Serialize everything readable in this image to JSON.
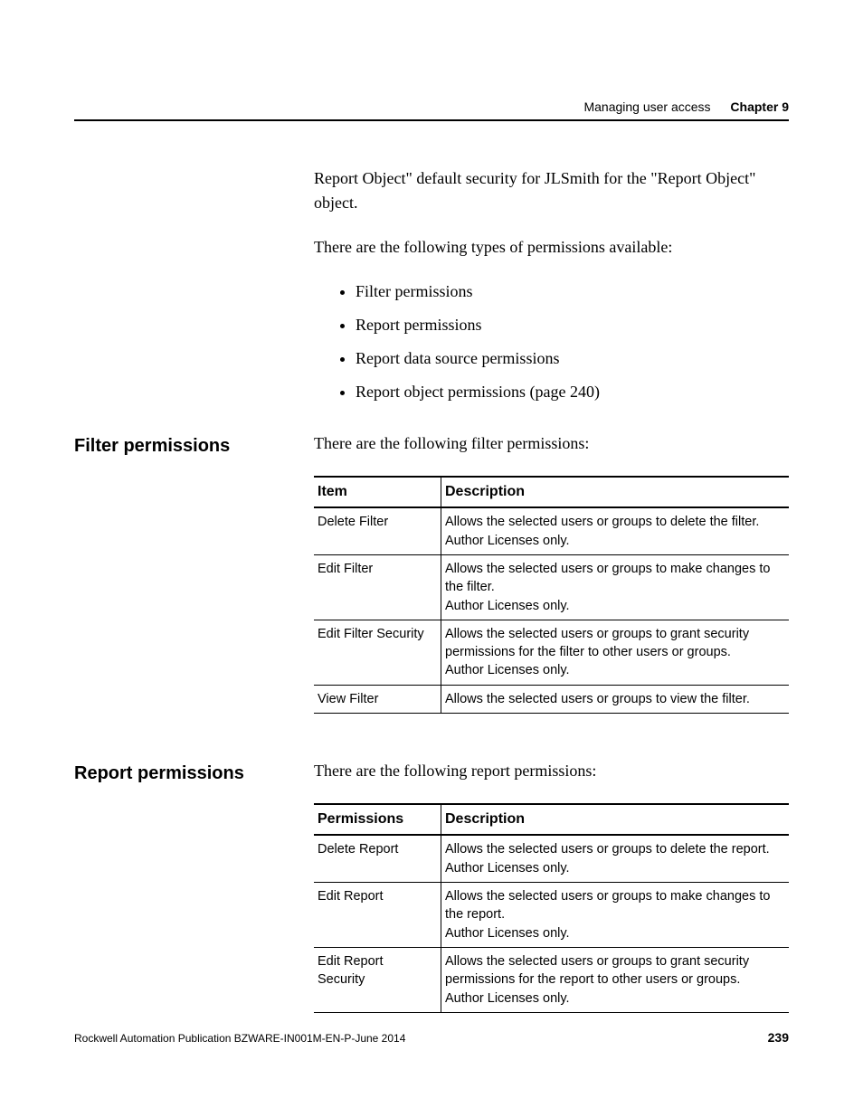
{
  "header": {
    "section": "Managing user access",
    "chapter": "Chapter 9"
  },
  "intro": {
    "p1": "Report Object\" default security for JLSmith for the \"Report Object\" object.",
    "p2": "There are the following types of permissions available:",
    "bullets": [
      "Filter permissions",
      "Report permissions",
      "Report data source permissions",
      "Report object permissions (page 240)"
    ]
  },
  "sections": [
    {
      "title": "Filter permissions",
      "lead": "There are the following filter permissions:",
      "headers": [
        "Item",
        "Description"
      ],
      "rows": [
        {
          "c0": "Delete Filter",
          "c1": "Allows the selected users or groups to delete the filter.\nAuthor Licenses only."
        },
        {
          "c0": "Edit Filter",
          "c1": "Allows the selected users or groups to make changes to the filter.\nAuthor Licenses only."
        },
        {
          "c0": "Edit Filter Security",
          "c1": "Allows the selected users or groups to grant security permissions for the filter to other users or groups.\nAuthor Licenses only."
        },
        {
          "c0": "View Filter",
          "c1": "Allows the selected users or groups to view the filter."
        }
      ]
    },
    {
      "title": "Report permissions",
      "lead": "There are the following report permissions:",
      "headers": [
        "Permissions",
        "Description"
      ],
      "rows": [
        {
          "c0": "Delete Report",
          "c1": "Allows the selected users or groups to delete the report.\nAuthor Licenses only."
        },
        {
          "c0": "Edit Report",
          "c1": "Allows the selected users or groups to make changes to the report.\nAuthor Licenses only."
        },
        {
          "c0": "Edit Report Security",
          "c1": "Allows the selected users or groups to grant security permissions for the report to other users or groups.\nAuthor Licenses only."
        }
      ]
    }
  ],
  "footer": {
    "pub": "Rockwell Automation Publication BZWARE-IN001M-EN-P-June 2014",
    "page": "239"
  }
}
